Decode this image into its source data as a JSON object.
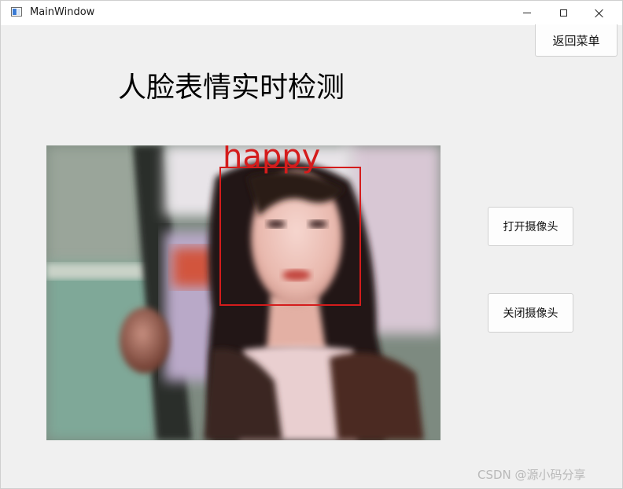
{
  "window": {
    "title": "MainWindow"
  },
  "header": {
    "title": "人脸表情实时检测"
  },
  "buttons": {
    "menu_label": "返回菜单",
    "open_camera_label": "打开摄像头",
    "close_camera_label": "关闭摄像头"
  },
  "video": {
    "emotion_label": "happy",
    "box_color": "#d41c1c"
  },
  "watermark": {
    "text": "CSDN @源小码分享"
  },
  "colors": {
    "window_bg": "#f0f0f0",
    "button_bg": "#fdfdfd"
  }
}
